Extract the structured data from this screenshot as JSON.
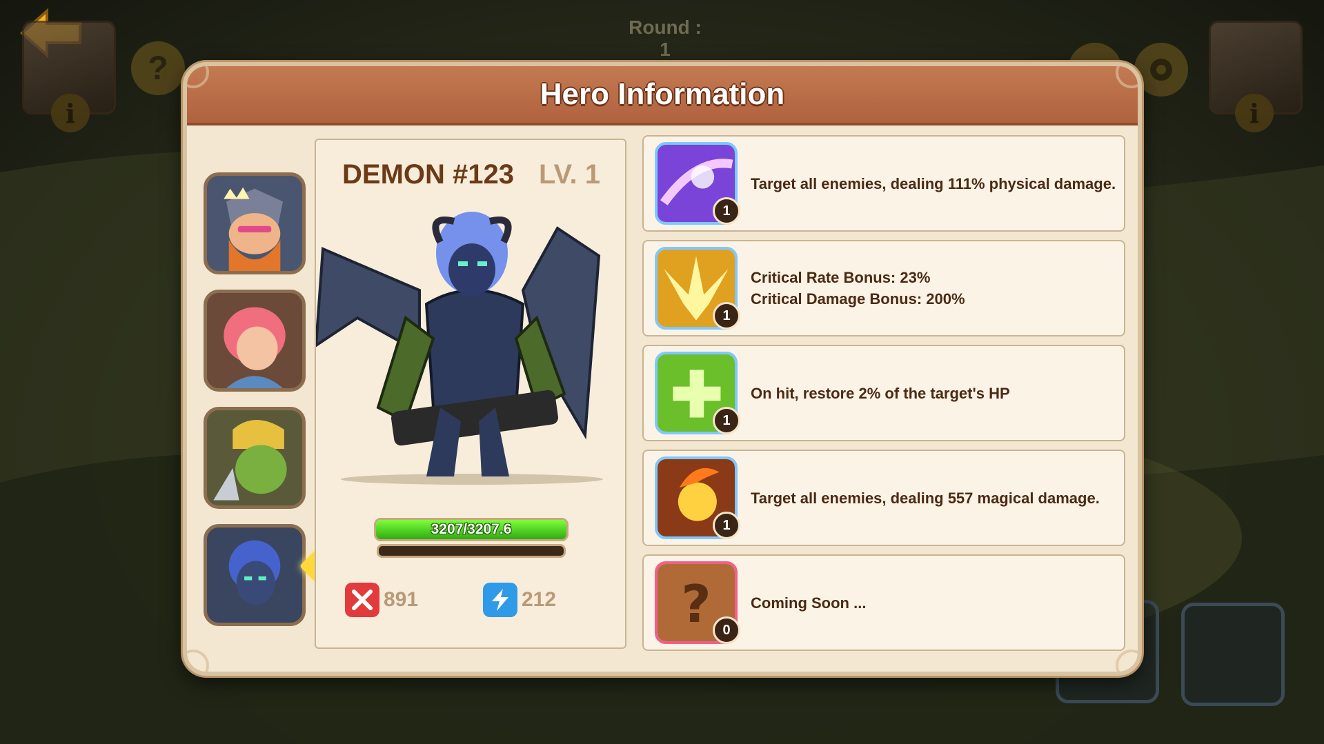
{
  "hud": {
    "round_label": "Round : 1",
    "help_glyph": "?",
    "info_glyph": "i"
  },
  "modal": {
    "title": "Hero Information"
  },
  "hero": {
    "name": "DEMON #123",
    "level": "LV. 1",
    "hp_text": "3207/3207.6",
    "hp_fraction": 1.0,
    "mana_fraction": 0.0,
    "attack": "891",
    "speed": "212"
  },
  "roster": [
    {
      "name": "dwarf-king-hero",
      "crowned": true
    },
    {
      "name": "red-hair-girl-hero",
      "crowned": false
    },
    {
      "name": "orc-hero",
      "crowned": false
    },
    {
      "name": "demon-hero",
      "crowned": false,
      "selected": true
    }
  ],
  "skills": [
    {
      "icon": "purple-slash-icon",
      "border": "#7fc8ff",
      "level": "1",
      "lines": [
        "Target all enemies, dealing 111% physical damage."
      ]
    },
    {
      "icon": "golden-burst-icon",
      "border": "#7fc8ff",
      "level": "1",
      "lines": [
        "Critical Rate Bonus: 23%",
        "Critical Damage Bonus: 200%"
      ]
    },
    {
      "icon": "green-heal-cross-icon",
      "border": "#7fc8ff",
      "level": "1",
      "lines": [
        "On hit, restore 2% of the target's HP"
      ]
    },
    {
      "icon": "fireball-icon",
      "border": "#7fc8ff",
      "level": "1",
      "lines": [
        "Target all enemies, dealing 557 magical damage."
      ]
    },
    {
      "icon": "question-mark-icon",
      "border": "#f0608a",
      "level": "0",
      "lines": [
        "Coming Soon ..."
      ]
    }
  ],
  "colors": {
    "header": "#b8693f",
    "panel": "#f3e7d2",
    "hp_green": "#4fd11f",
    "attack_red": "#e23b3b",
    "speed_blue": "#2f9ae8"
  }
}
